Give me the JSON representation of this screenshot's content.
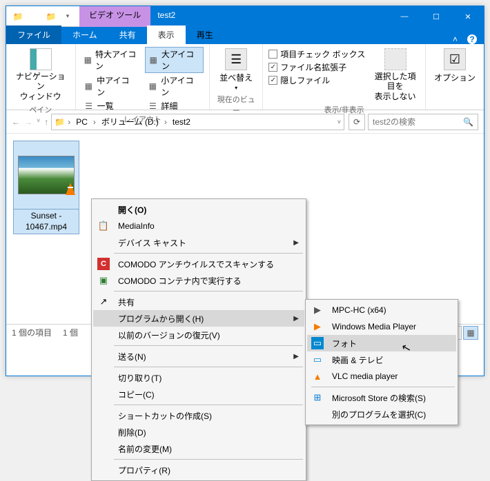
{
  "title": "test2",
  "contextual_tab": "ビデオ ツール",
  "tabs": {
    "file": "ファイル",
    "home": "ホーム",
    "share": "共有",
    "view": "表示",
    "play": "再生"
  },
  "ribbon": {
    "pane": {
      "nav_btn": "ナビゲーション\nウィンドウ",
      "label": "ペイン"
    },
    "layout": {
      "items": [
        "特大アイコン",
        "大アイコン",
        "中アイコン",
        "小アイコン",
        "一覧",
        "詳細"
      ],
      "label": "レイアウト"
    },
    "sort": {
      "btn": "並べ替え",
      "label": "現在のビュー"
    },
    "showhide": {
      "checks": [
        "項目チェック ボックス",
        "ファイル名拡張子",
        "隠しファイル"
      ],
      "checked": [
        false,
        true,
        true
      ],
      "btn": "選択した項目を\n表示しない",
      "label": "表示/非表示"
    },
    "options": {
      "btn": "オプション"
    }
  },
  "breadcrumb": {
    "items": [
      "PC",
      "ボリューム (D:)",
      "test2"
    ]
  },
  "search_placeholder": "test2の検索",
  "file": {
    "name": "Sunset - 10467.mp4"
  },
  "status": {
    "count": "1 個の項目",
    "sel": "1 個"
  },
  "context_menu": {
    "items": [
      {
        "type": "item",
        "text": "開く(O)",
        "bold": true
      },
      {
        "type": "item",
        "text": "MediaInfo",
        "icon": "📋"
      },
      {
        "type": "item",
        "text": "デバイス キャスト",
        "arrow": true
      },
      {
        "type": "sep"
      },
      {
        "type": "item",
        "text": "COMODO アンチウイルスでスキャンする",
        "icon": "C",
        "iconbg": "#d32f2f"
      },
      {
        "type": "item",
        "text": "COMODO コンテナ内で実行する",
        "icon": "▣",
        "iconcolor": "#2e7d32"
      },
      {
        "type": "sep"
      },
      {
        "type": "item",
        "text": "共有",
        "icon": "↗"
      },
      {
        "type": "item",
        "text": "プログラムから開く(H)",
        "arrow": true,
        "hover": true
      },
      {
        "type": "item",
        "text": "以前のバージョンの復元(V)"
      },
      {
        "type": "sep"
      },
      {
        "type": "item",
        "text": "送る(N)",
        "arrow": true
      },
      {
        "type": "sep"
      },
      {
        "type": "item",
        "text": "切り取り(T)"
      },
      {
        "type": "item",
        "text": "コピー(C)"
      },
      {
        "type": "sep"
      },
      {
        "type": "item",
        "text": "ショートカットの作成(S)"
      },
      {
        "type": "item",
        "text": "削除(D)"
      },
      {
        "type": "item",
        "text": "名前の変更(M)"
      },
      {
        "type": "sep"
      },
      {
        "type": "item",
        "text": "プロパティ(R)"
      }
    ]
  },
  "submenu": {
    "items": [
      {
        "text": "MPC-HC (x64)",
        "icon": "▶",
        "iconcolor": "#555"
      },
      {
        "text": "Windows Media Player",
        "icon": "▶",
        "iconcolor": "#f57c00"
      },
      {
        "text": "フォト",
        "icon": "▭",
        "iconbg": "#0288d1",
        "hover": true
      },
      {
        "text": "映画 & テレビ",
        "icon": "▭",
        "iconcolor": "#0288d1"
      },
      {
        "text": "VLC media player",
        "icon": "▲",
        "iconcolor": "#f57c00"
      }
    ],
    "footer": [
      {
        "text": "Microsoft Store の検索(S)",
        "icon": "⊞",
        "iconcolor": "#0078d7"
      },
      {
        "text": "別のプログラムを選択(C)"
      }
    ]
  }
}
